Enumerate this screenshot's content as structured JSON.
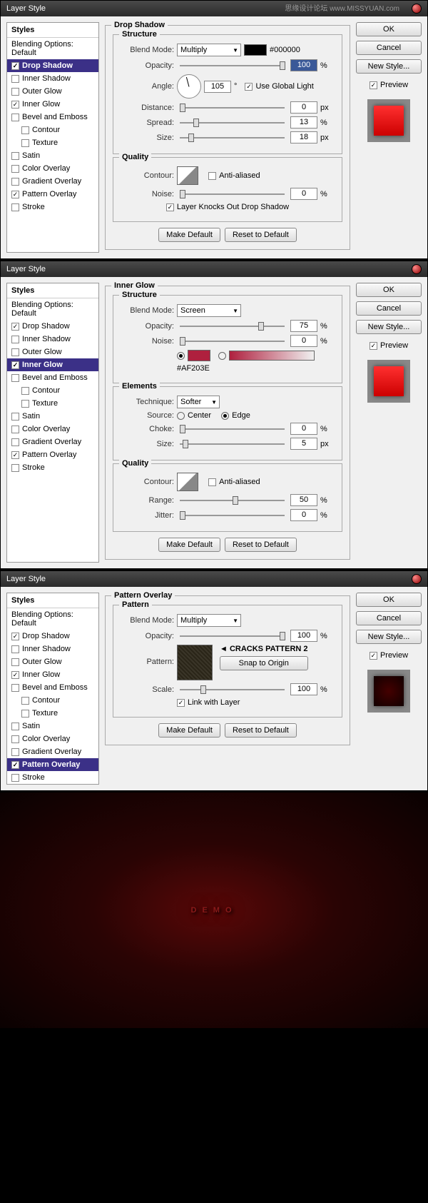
{
  "dialogs": [
    {
      "title": "Layer Style",
      "active": "Drop Shadow",
      "panel": "Drop Shadow",
      "structure": {
        "blendMode": "Multiply",
        "color": "#000000",
        "opacity": "100",
        "angle": "105",
        "globalLight": true,
        "distance": "0",
        "spread": "13",
        "size": "18"
      },
      "quality": {
        "antialiased": false,
        "noise": "0",
        "knocksOut": true
      },
      "preview": "red"
    },
    {
      "title": "Layer Style",
      "active": "Inner Glow",
      "panel": "Inner Glow",
      "structure": {
        "blendMode": "Screen",
        "opacity": "75",
        "noise": "0",
        "colorHex": "#AF203E"
      },
      "elements": {
        "technique": "Softer",
        "source": "Edge",
        "choke": "0",
        "size": "5"
      },
      "quality": {
        "antialiased": false,
        "range": "50",
        "jitter": "0"
      },
      "preview": "red"
    },
    {
      "title": "Layer Style",
      "active": "Pattern Overlay",
      "panel": "Pattern Overlay",
      "pattern": {
        "blendMode": "Multiply",
        "opacity": "100",
        "label": "CRACKS PATTERN 2",
        "snap": "Snap to Origin",
        "scale": "100",
        "link": true
      },
      "preview": "dark"
    }
  ],
  "styles": {
    "header": "Styles",
    "blending": "Blending Options: Default",
    "items": [
      "Drop Shadow",
      "Inner Shadow",
      "Outer Glow",
      "Inner Glow",
      "Bevel and Emboss",
      "Contour",
      "Texture",
      "Satin",
      "Color Overlay",
      "Gradient Overlay",
      "Pattern Overlay",
      "Stroke"
    ],
    "checked": [
      "Drop Shadow",
      "Inner Glow",
      "Pattern Overlay"
    ]
  },
  "buttons": {
    "ok": "OK",
    "cancel": "Cancel",
    "newStyle": "New Style...",
    "preview": "Preview",
    "makeDefault": "Make Default",
    "reset": "Reset to Default"
  },
  "labels": {
    "blendMode": "Blend Mode:",
    "opacity": "Opacity:",
    "angle": "Angle:",
    "useGlobal": "Use Global Light",
    "distance": "Distance:",
    "spread": "Spread:",
    "size": "Size:",
    "contour": "Contour:",
    "antialiased": "Anti-aliased",
    "noise": "Noise:",
    "knocks": "Layer Knocks Out Drop Shadow",
    "technique": "Technique:",
    "source": "Source:",
    "center": "Center",
    "edge": "Edge",
    "choke": "Choke:",
    "range": "Range:",
    "jitter": "Jitter:",
    "pattern": "Pattern:",
    "scale": "Scale:",
    "link": "Link with Layer",
    "structure": "Structure",
    "quality": "Quality",
    "elements": "Elements",
    "patternGroup": "Pattern",
    "px": "px",
    "pct": "%",
    "deg": "°"
  },
  "watermark": "思缘设计论坛 www.MISSYUAN.com",
  "demo": "DEMO"
}
